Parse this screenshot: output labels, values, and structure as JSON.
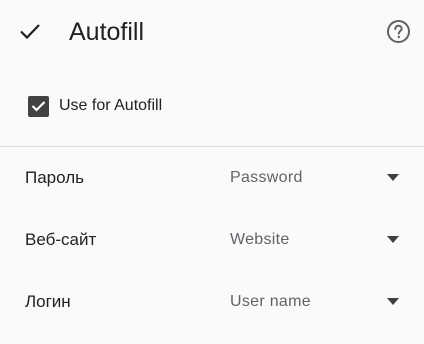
{
  "header": {
    "title": "Autofill",
    "confirm_icon": "check-icon",
    "help_icon": "help-circle-icon"
  },
  "use_autofill": {
    "label": "Use for Autofill",
    "checked": true
  },
  "fields": [
    {
      "label": "Пароль",
      "value": "Password"
    },
    {
      "label": "Веб-сайт",
      "value": "Website"
    },
    {
      "label": "Логин",
      "value": "User name"
    }
  ],
  "colors": {
    "background": "#fafafa",
    "text": "#202124",
    "secondary_text": "#5f6368",
    "checkbox": "#424242",
    "divider": "#dadce0"
  }
}
